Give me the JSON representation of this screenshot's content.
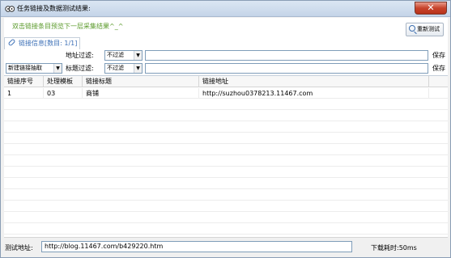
{
  "window": {
    "title": "任务链接及数据测试结果:",
    "close_label": "✕"
  },
  "toolbar": {
    "hint": "双击链接条目预览下一层采集结果^_^",
    "refresh_label": "重新测试"
  },
  "tab": {
    "label": "链接信息[数目: 1/1]"
  },
  "filters": {
    "address_label": "地址过滤:",
    "address_mode": "不过滤",
    "address_value": "",
    "title_label": "标题过滤:",
    "title_mode": "不过滤",
    "title_value": "",
    "save_label": "保存",
    "extract_mode": "新建链接抽取"
  },
  "table": {
    "columns": [
      "链接序号",
      "处理模板",
      "链接标题",
      "链接地址"
    ],
    "rows": [
      [
        "1",
        "03",
        "商铺",
        "http://suzhou0378213.11467.com"
      ]
    ]
  },
  "status": {
    "test_address_label": "测试地址:",
    "test_address": "http://blog.11467.com/b429220.htm",
    "download_time": "下载耗时:50ms"
  }
}
